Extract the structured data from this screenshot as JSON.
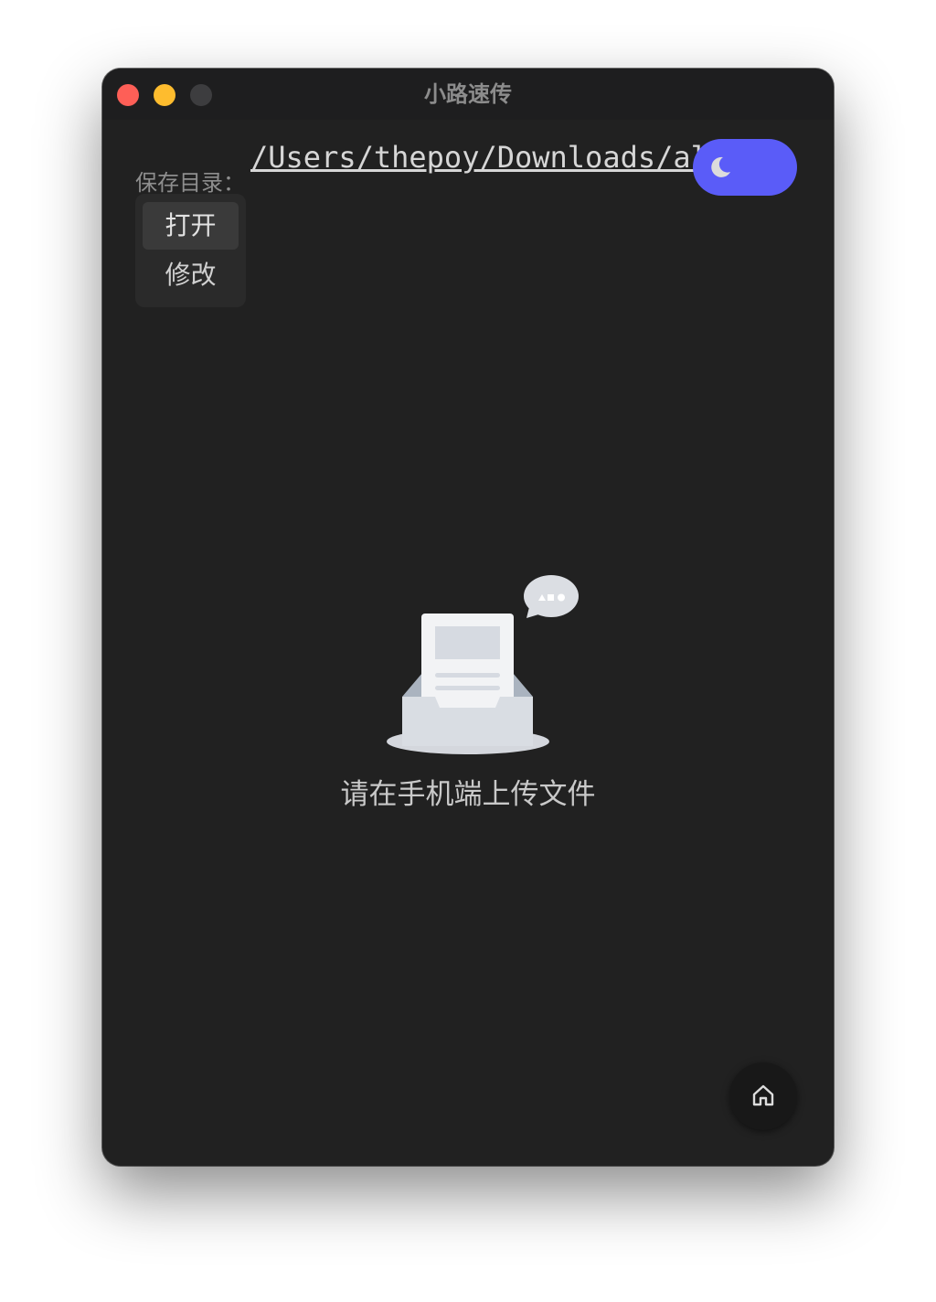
{
  "window": {
    "title": "小路速传"
  },
  "save_dir": {
    "label": "保存目录：",
    "path": "/Users/thepoy/Downloads/alley"
  },
  "menu": {
    "items": [
      {
        "label": "打开"
      },
      {
        "label": "修改"
      }
    ]
  },
  "theme_toggle": {
    "mode": "dark",
    "icon": "moon-icon"
  },
  "empty_state": {
    "icon": "empty-inbox-illustration",
    "message": "请在手机端上传文件"
  },
  "home": {
    "icon": "home-icon"
  },
  "colors": {
    "window_bg": "#212121",
    "titlebar_bg": "#1e1e1f",
    "close": "#fe5f57",
    "minimize": "#febc2e",
    "zoom_disabled": "#3d3d3f",
    "accent": "#5a5cf8",
    "text_primary": "#d6d6d6",
    "text_muted": "#8e8e8e"
  }
}
